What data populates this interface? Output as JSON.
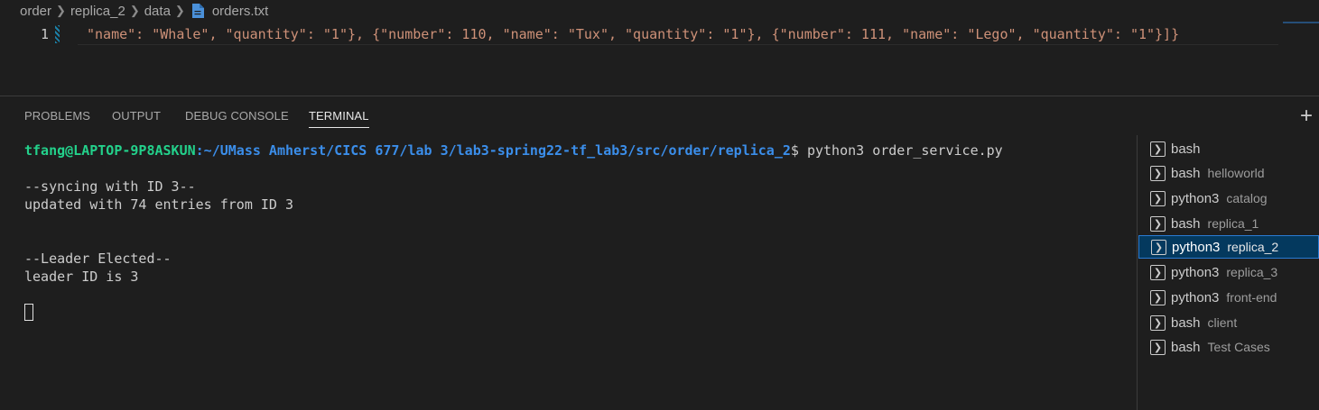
{
  "breadcrumb": [
    "order",
    "replica_2",
    "data",
    "orders.txt"
  ],
  "editor": {
    "line_number": "1",
    "code": "\"name\": \"Whale\", \"quantity\": \"1\"}, {\"number\": 110, \"name\": \"Tux\", \"quantity\": \"1\"}, {\"number\": 111, \"name\": \"Lego\", \"quantity\": \"1\"}]}"
  },
  "panel_tabs": [
    "PROBLEMS",
    "OUTPUT",
    "DEBUG CONSOLE",
    "TERMINAL"
  ],
  "active_tab": "TERMINAL",
  "terminal": {
    "prompt_user": "tfang@LAPTOP-9P8ASKUN",
    "prompt_path": ":~/UMass Amherst/CICS 677/lab 3/lab3-spring22-tf_lab3/src/order/replica_2",
    "prompt_cmd": "$ python3 order_service.py",
    "lines": [
      "--syncing with ID 3--",
      "updated with 74 entries from ID 3",
      "--Leader Elected--",
      "leader ID is 3"
    ]
  },
  "terminal_list": [
    {
      "name": "bash",
      "desc": ""
    },
    {
      "name": "bash",
      "desc": "helloworld"
    },
    {
      "name": "python3",
      "desc": "catalog"
    },
    {
      "name": "bash",
      "desc": "replica_1"
    },
    {
      "name": "python3",
      "desc": "replica_2"
    },
    {
      "name": "python3",
      "desc": "replica_3"
    },
    {
      "name": "python3",
      "desc": "front-end"
    },
    {
      "name": "bash",
      "desc": "client"
    },
    {
      "name": "bash",
      "desc": "Test Cases"
    }
  ],
  "colors": {
    "prompt_user": "#23d18b",
    "prompt_path": "#3b8eea",
    "selection": "#04395e"
  },
  "icons": [
    "chevron-right-icon",
    "file-icon",
    "plus-icon",
    "terminal-icon"
  ]
}
